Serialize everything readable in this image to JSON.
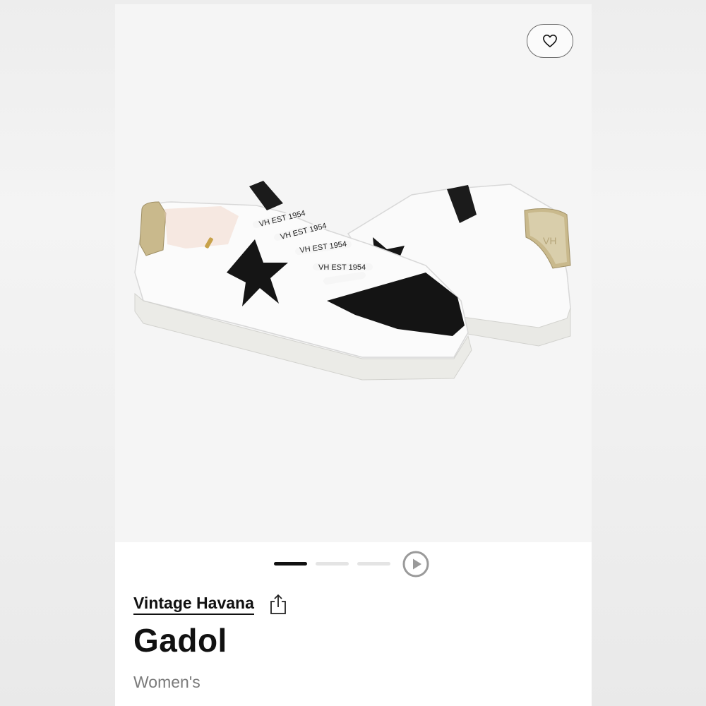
{
  "header": {
    "favorite_icon": "heart-outline-icon"
  },
  "gallery": {
    "image_subject": "white low-top sneakers with black star and gold heel tab",
    "slides_total": 3,
    "active_slide": 1,
    "video_icon": "play-circle-icon",
    "lace_print": "VH EST 1954",
    "heel_print": "VH"
  },
  "product": {
    "brand": "Vintage Havana",
    "share_icon": "share-icon",
    "name": "Gadol",
    "category": "Women's"
  },
  "colors": {
    "text": "#111111",
    "muted": "#7a7a7a",
    "inactive_dot": "#e4e4e4"
  }
}
